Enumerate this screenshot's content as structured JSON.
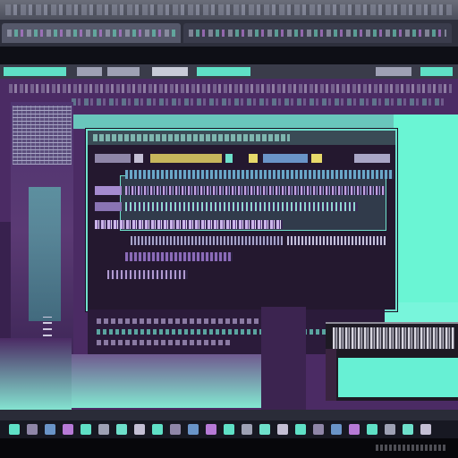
{
  "palette": {
    "accent": "#6af5d4",
    "background": "#4b2b64",
    "dark": "#0e0f16"
  },
  "menubar": {
    "items": []
  },
  "taskbar": {
    "icons": [
      "app-icon",
      "app-icon",
      "app-icon",
      "app-icon",
      "app-icon",
      "app-icon",
      "app-icon",
      "app-icon",
      "app-icon",
      "app-icon",
      "app-icon",
      "app-icon",
      "app-icon",
      "app-icon",
      "app-icon",
      "app-icon",
      "app-icon",
      "app-icon",
      "app-icon",
      "app-icon",
      "app-icon",
      "app-icon",
      "app-icon",
      "app-icon"
    ]
  }
}
